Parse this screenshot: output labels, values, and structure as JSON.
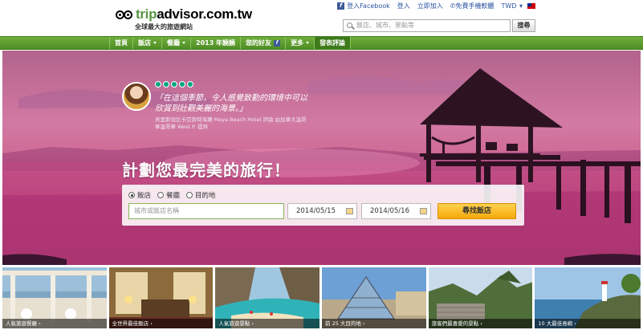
{
  "header": {
    "brand_prefix": "trip",
    "brand_suffix": "advisor.com.tw",
    "tagline": "全球最大的旅遊網站",
    "links": {
      "facebook": "登入Facebook",
      "login": "登入",
      "register": "立即加入",
      "mobile": "免費手機軟體",
      "currency": "TWD"
    },
    "search_placeholder": "飯店、城市、景點等",
    "search_button": "搜尋"
  },
  "nav": {
    "items": [
      {
        "label": "首頁"
      },
      {
        "label": "飯店"
      },
      {
        "label": "餐廳"
      },
      {
        "label": "2013 年饒饒"
      },
      {
        "label": "您的好友"
      },
      {
        "label": "更多"
      },
      {
        "label": "發表評論"
      }
    ]
  },
  "hero": {
    "quote": "「在這個季節，令人感覺致勤的環境中可以欣賞到壯觀美麗的海景。」",
    "quote_meta": "貝里斯坦比卡亞斯特海灘 Maya Beach Hotel 評論 由加拿大溫哥華溫哥華 West P. 提供",
    "headline": "計劃您最完美的旅行！",
    "search": {
      "radio_hotel": "飯店",
      "radio_restaurant": "餐廳",
      "radio_destination": "目的地",
      "selected": "飯店",
      "hotel_placeholder": "城市或飯店名稱",
      "checkin": "2014/05/15",
      "checkout": "2014/05/16",
      "find_button": "尋找飯店"
    }
  },
  "thumbs": [
    {
      "caption": "人氣旅遊餐廳 ›"
    },
    {
      "caption": "全世界最佳飯店 ›"
    },
    {
      "caption": "人氣旅遊景點 ›"
    },
    {
      "caption": "前 25 大目的地 ›"
    },
    {
      "caption": "旅客們最喜愛的景點 ›"
    },
    {
      "caption": "10 大最佳島嶼 ›"
    }
  ],
  "colors": {
    "brand_green": "#589442",
    "nav_green": "#5a9a2e",
    "button_yellow": "#f7b825"
  }
}
